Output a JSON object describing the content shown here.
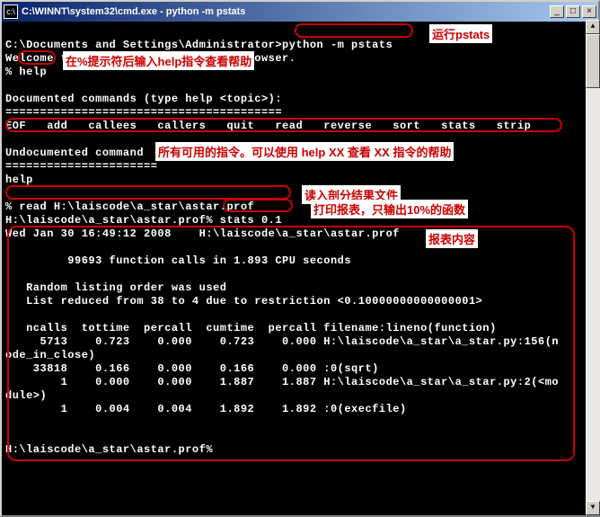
{
  "window": {
    "title": "C:\\WINNT\\system32\\cmd.exe - python  -m pstats"
  },
  "terminal": {
    "line1": "C:\\Documents and Settings\\Administrator>python -m pstats",
    "line2": "Welcome to the profile statistics browser.",
    "prompt1": "% help",
    "docHeader": "Documented commands (type help <topic>):",
    "docSep": "========================================",
    "cmds": "EOF   add   callees   callers   quit   read   reverse   sort   stats   strip",
    "undoc": "Undocumented command",
    "undocSep": "======================",
    "help2": "help",
    "readCmd": "% read H:\\laiscode\\a_star\\astar.prof",
    "statsLine": "H:\\laiscode\\a_star\\astar.prof% stats 0.1",
    "dateLine": "Wed Jan 30 16:49:12 2008    H:\\laiscode\\a_star\\astar.prof",
    "calls": "         99693 function calls in 1.893 CPU seconds",
    "order": "   Random listing order was used",
    "reduced": "   List reduced from 38 to 4 due to restriction <0.10000000000000001>",
    "hdr": "   ncalls  tottime  percall  cumtime  percall filename:lineno(function)",
    "r1": "     5713    0.723    0.000    0.723    0.000 H:\\laiscode\\a_star\\a_star.py:156(n",
    "r1b": "ode_in_close)",
    "r2": "    33818    0.166    0.000    0.166    0.000 :0(sqrt)",
    "r3": "        1    0.000    0.000    1.887    1.887 H:\\laiscode\\a_star\\a_star.py:2(<mo",
    "r3b": "dule>)",
    "r4": "        1    0.004    0.004    1.892    1.892 :0(execfile)",
    "endPrompt": "H:\\laiscode\\a_star\\astar.prof%"
  },
  "annotations": {
    "runPstats": "运行pstats",
    "helpHint": "在%提示符后输入help指令查看帮助",
    "allCmds": "所有可用的指令。可以使用 help XX 查看 XX 指令的帮助",
    "readFile": "读入剖分结果文件",
    "printReport": "打印报表，只输出10%的函数",
    "reportContent": "报表内容"
  }
}
